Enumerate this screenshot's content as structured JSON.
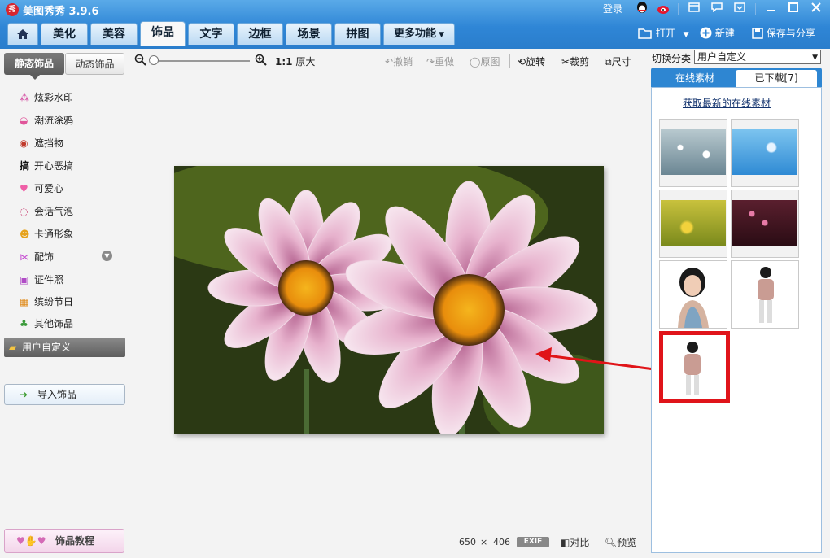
{
  "app": {
    "logo": "秀",
    "title": "美图秀秀 3.9.6"
  },
  "titlebar": {
    "login": "登录"
  },
  "tabs": [
    {
      "label": ""
    },
    {
      "label": "美化"
    },
    {
      "label": "美容"
    },
    {
      "label": "饰品"
    },
    {
      "label": "文字"
    },
    {
      "label": "边框"
    },
    {
      "label": "场景"
    },
    {
      "label": "拼图"
    },
    {
      "label": "更多功能"
    }
  ],
  "file_toolbar": {
    "open": "打开",
    "new": "新建",
    "save_share": "保存与分享"
  },
  "zoom": {
    "ratio_label": "1:1",
    "original_size": "原大"
  },
  "edit_toolbar": {
    "undo": "撤销",
    "redo": "重做",
    "original": "原图",
    "rotate": "旋转",
    "crop": "裁剪",
    "size": "尺寸"
  },
  "left_panel": {
    "tabs": {
      "static": "静态饰品",
      "dynamic": "动态饰品"
    },
    "items": [
      {
        "icon": "sparkle-icon",
        "label": "炫彩水印"
      },
      {
        "icon": "lips-icon",
        "label": "潮流涂鸦"
      },
      {
        "icon": "mask-icon",
        "label": "遮挡物"
      },
      {
        "icon": "prank-icon",
        "label": "开心恶搞"
      },
      {
        "icon": "heart-icon",
        "label": "可爱心"
      },
      {
        "icon": "speech-bubble-icon",
        "label": "会话气泡"
      },
      {
        "icon": "cartoon-face-icon",
        "label": "卡通形象"
      },
      {
        "icon": "bow-icon",
        "label": "配饰"
      },
      {
        "icon": "id-photo-icon",
        "label": "证件照"
      },
      {
        "icon": "gift-icon",
        "label": "缤纷节日"
      },
      {
        "icon": "tree-icon",
        "label": "其他饰品"
      }
    ],
    "selected": {
      "icon": "folder-icon",
      "label": "用户自定义"
    },
    "import_button": "导入饰品",
    "tutorial_button": "饰品教程",
    "prank_glyph": "搞"
  },
  "right_panel": {
    "category_label": "切换分类",
    "category_value": "用户自定义",
    "tabs": {
      "online": "在线素材",
      "downloaded": "已下载[7]"
    },
    "get_latest_link": "获取最新的在线素材"
  },
  "status_bar": {
    "width": "650",
    "times": "×",
    "height": "406",
    "exif": "EXIF",
    "compare": "对比",
    "preview": "预览"
  },
  "colors": {
    "title_blue": "#2f86d6",
    "highlight_red": "#e0141a",
    "arrow_red": "#e01418"
  }
}
